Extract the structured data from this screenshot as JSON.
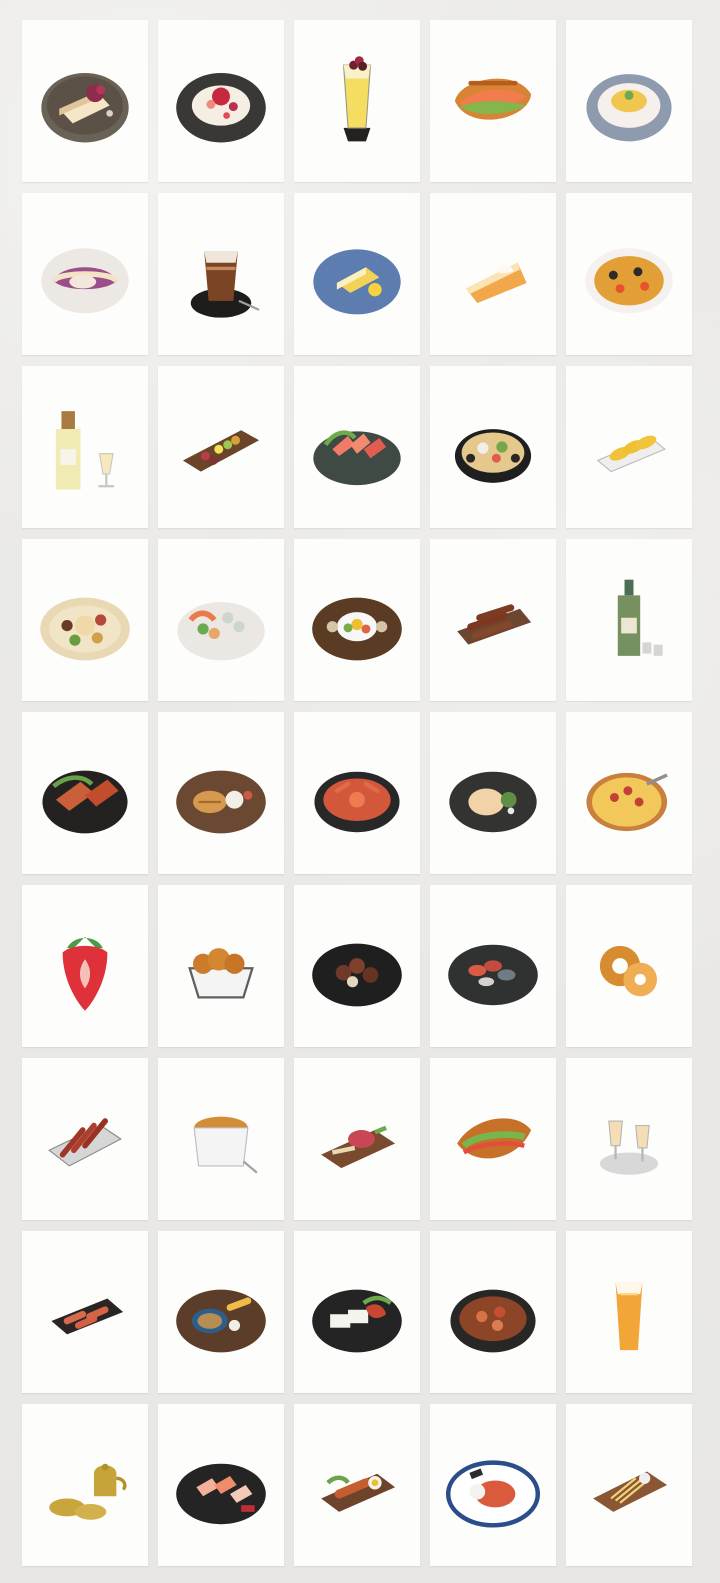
{
  "gallery": {
    "items": [
      {
        "icon": "cheesecake-plate-icon"
      },
      {
        "icon": "berry-rice-plate-icon"
      },
      {
        "icon": "lemon-soda-glass-icon"
      },
      {
        "icon": "croissant-sandwich-icon"
      },
      {
        "icon": "rice-plate-icon"
      },
      {
        "icon": "berry-tart-plate-icon"
      },
      {
        "icon": "iced-coffee-glass-icon"
      },
      {
        "icon": "lemon-cake-plate-icon"
      },
      {
        "icon": "apple-pie-slice-icon"
      },
      {
        "icon": "seafood-paella-icon"
      },
      {
        "icon": "wine-bottle-glass-icon"
      },
      {
        "icon": "charcuterie-board-icon"
      },
      {
        "icon": "sashimi-platter-icon"
      },
      {
        "icon": "hot-pot-icon"
      },
      {
        "icon": "fried-shrimp-tray-icon"
      },
      {
        "icon": "party-platter-icon"
      },
      {
        "icon": "seafood-platter-icon"
      },
      {
        "icon": "bibimbap-set-icon"
      },
      {
        "icon": "skewer-platter-icon"
      },
      {
        "icon": "soju-bottle-icon"
      },
      {
        "icon": "bbq-grill-icon"
      },
      {
        "icon": "katsu-set-icon"
      },
      {
        "icon": "crab-stew-icon"
      },
      {
        "icon": "dumpling-plate-icon"
      },
      {
        "icon": "pizza-icon"
      },
      {
        "icon": "strawberry-icon"
      },
      {
        "icon": "fried-chicken-basket-icon"
      },
      {
        "icon": "braised-dish-icon"
      },
      {
        "icon": "seafood-grill-icon"
      },
      {
        "icon": "bagels-icon"
      },
      {
        "icon": "skewers-grill-icon"
      },
      {
        "icon": "creme-brulee-icon"
      },
      {
        "icon": "beef-tartare-board-icon"
      },
      {
        "icon": "banh-mi-icon"
      },
      {
        "icon": "liqueur-glasses-icon"
      },
      {
        "icon": "sausage-tray-icon"
      },
      {
        "icon": "tempura-noodle-set-icon"
      },
      {
        "icon": "tofu-kimchi-icon"
      },
      {
        "icon": "stew-pan-icon"
      },
      {
        "icon": "beer-glass-icon"
      },
      {
        "icon": "makgeolli-kettle-icon"
      },
      {
        "icon": "sashimi-board-icon"
      },
      {
        "icon": "sausage-breakfast-board-icon"
      },
      {
        "icon": "spicy-noodle-plate-icon"
      },
      {
        "icon": "fries-board-icon"
      }
    ]
  }
}
